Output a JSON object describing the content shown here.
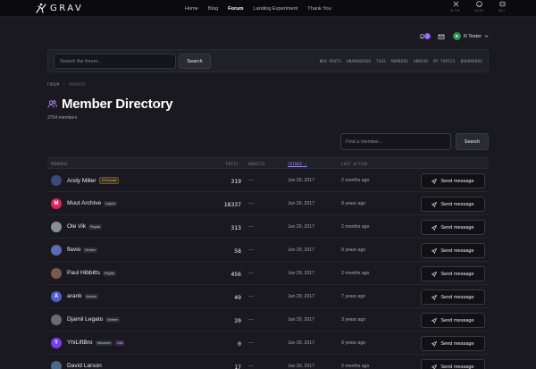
{
  "brand": {
    "name": "GRAV"
  },
  "nav": [
    "Home",
    "Blog",
    "Forum",
    "Landing Experiment",
    "Thank You"
  ],
  "nav_active": "Forum",
  "social": [
    {
      "icon": "x-icon",
      "count": "8.77K"
    },
    {
      "icon": "github-icon",
      "count": "15.2K"
    },
    {
      "icon": "discord-icon",
      "count": "5K+"
    }
  ],
  "user_bar": {
    "notifications": "2",
    "user_initial": "R",
    "user_name": "R Tester"
  },
  "forum_bar": {
    "search_placeholder": "Search the forum...",
    "search_button": "Search",
    "links": [
      "NEW POSTS",
      "UNANSWERED",
      "TAGS",
      "MEMBERS",
      "UNREAD",
      "MY TOPICS",
      "BOOKMARKS"
    ]
  },
  "breadcrumb": {
    "root": "FORUM",
    "separator": "/",
    "current": "MEMBERS"
  },
  "page": {
    "title": "Member Directory",
    "member_count": "3754 members"
  },
  "find": {
    "placeholder": "Find a member...",
    "button": "Search"
  },
  "table": {
    "columns": [
      "MEMBERS",
      "POSTS",
      "WEBSITE",
      "JOINED",
      "LAST ACTIVE"
    ],
    "sorted_column": "JOINED",
    "sort_arrow": "↓",
    "send_label": "Send message",
    "rows": [
      {
        "name": "Andy Miller",
        "badge": "TE Founder",
        "badge_style": "gold",
        "badge2": "",
        "posts": "319",
        "website": "—",
        "joined": "Jun 29, 2017",
        "last": "2 months ago",
        "avatar_color": "#3a4a7a",
        "initial": ""
      },
      {
        "name": "Muut Archive",
        "badge": "Legend",
        "badge_style": "",
        "badge2": "",
        "posts": "18337",
        "website": "—",
        "joined": "Jun 29, 2017",
        "last": "9 years ago",
        "avatar_color": "#e0245e",
        "initial": "M"
      },
      {
        "name": "Ole Vik",
        "badge": "Regular",
        "badge_style": "",
        "badge2": "",
        "posts": "313",
        "website": "—",
        "joined": "Jun 29, 2017",
        "last": "2 months ago",
        "avatar_color": "#8d8d96",
        "initial": ""
      },
      {
        "name": "flavio",
        "badge": "Member",
        "badge_style": "",
        "badge2": "",
        "posts": "58",
        "website": "—",
        "joined": "Jun 29, 2017",
        "last": "9 years ago",
        "avatar_color": "#5b6bb5",
        "initial": ""
      },
      {
        "name": "Paul Hibbitts",
        "badge": "Regular",
        "badge_style": "",
        "badge2": "",
        "posts": "456",
        "website": "—",
        "joined": "Jun 29, 2017",
        "last": "2 months ago",
        "avatar_color": "#7a5a4a",
        "initial": ""
      },
      {
        "name": "arank",
        "badge": "Member",
        "badge_style": "",
        "badge2": "",
        "posts": "49",
        "website": "—",
        "joined": "Jun 29, 2017",
        "last": "7 years ago",
        "avatar_color": "#4f5fd0",
        "initial": "A"
      },
      {
        "name": "Djamil Legato",
        "badge": "Member",
        "badge_style": "",
        "badge2": "",
        "posts": "20",
        "website": "—",
        "joined": "Jun 29, 2017",
        "last": "3 years ago",
        "avatar_color": "#6a6a72",
        "initial": ""
      },
      {
        "name": "YhiLiftBro",
        "badge": "Newcomer",
        "badge_style": "",
        "badge2": "Club",
        "posts": "0",
        "website": "—",
        "joined": "Jun 30, 2017",
        "last": "9 years ago",
        "avatar_color": "#7c3aed",
        "initial": "Y"
      },
      {
        "name": "David Larson",
        "badge": "",
        "badge_style": "",
        "badge2": "",
        "posts": "17",
        "website": "—",
        "joined": "Jun 30, 2017",
        "last": "2 months ago",
        "avatar_color": "#4a6a8a",
        "initial": ""
      }
    ]
  },
  "colors": {
    "accent": "#8b5cf6",
    "background": "#19191f",
    "topbar": "#0b0b0e"
  }
}
